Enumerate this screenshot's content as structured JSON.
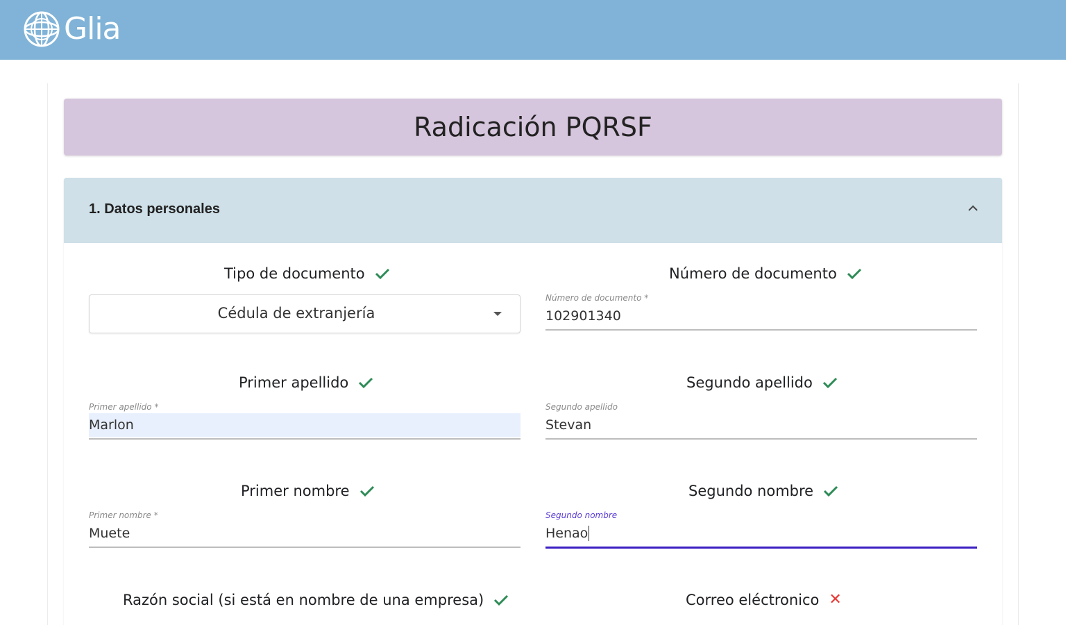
{
  "app": {
    "brand": "Glia"
  },
  "page": {
    "title": "Radicación PQRSF"
  },
  "section": {
    "title": "1. Datos personales"
  },
  "fields": {
    "tipo_documento": {
      "heading": "Tipo de documento",
      "value": "Cédula de extranjería",
      "status": "valid"
    },
    "numero_documento": {
      "heading": "Número de documento",
      "label": "Número de documento *",
      "value": "102901340",
      "status": "valid"
    },
    "primer_apellido": {
      "heading": "Primer apellido",
      "label": "Primer apellido *",
      "value": "Marlon",
      "status": "valid"
    },
    "segundo_apellido": {
      "heading": "Segundo apellido",
      "label": "Segundo apellido",
      "value": "Stevan",
      "status": "valid"
    },
    "primer_nombre": {
      "heading": "Primer nombre",
      "label": "Primer nombre *",
      "value": "Muete",
      "status": "valid"
    },
    "segundo_nombre": {
      "heading": "Segundo nombre",
      "label": "Segundo nombre",
      "value": "Henao",
      "status": "valid"
    },
    "razon_social": {
      "heading": "Razón social (si está en nombre de una empresa)",
      "status": "valid"
    },
    "correo": {
      "heading": "Correo eléctronico",
      "status": "invalid"
    }
  },
  "colors": {
    "topbar": "#80b3d7",
    "title_banner": "#d6c6dd",
    "section_header": "#cfe0e8",
    "valid_check": "#2e8b57",
    "invalid_x": "#e53935",
    "focus_underline": "#3b1fc2"
  },
  "icons": {
    "logo": "glia-sphere-icon",
    "valid": "check-icon",
    "invalid": "x-icon",
    "collapse": "chevron-up-icon",
    "dropdown": "caret-down-icon"
  }
}
